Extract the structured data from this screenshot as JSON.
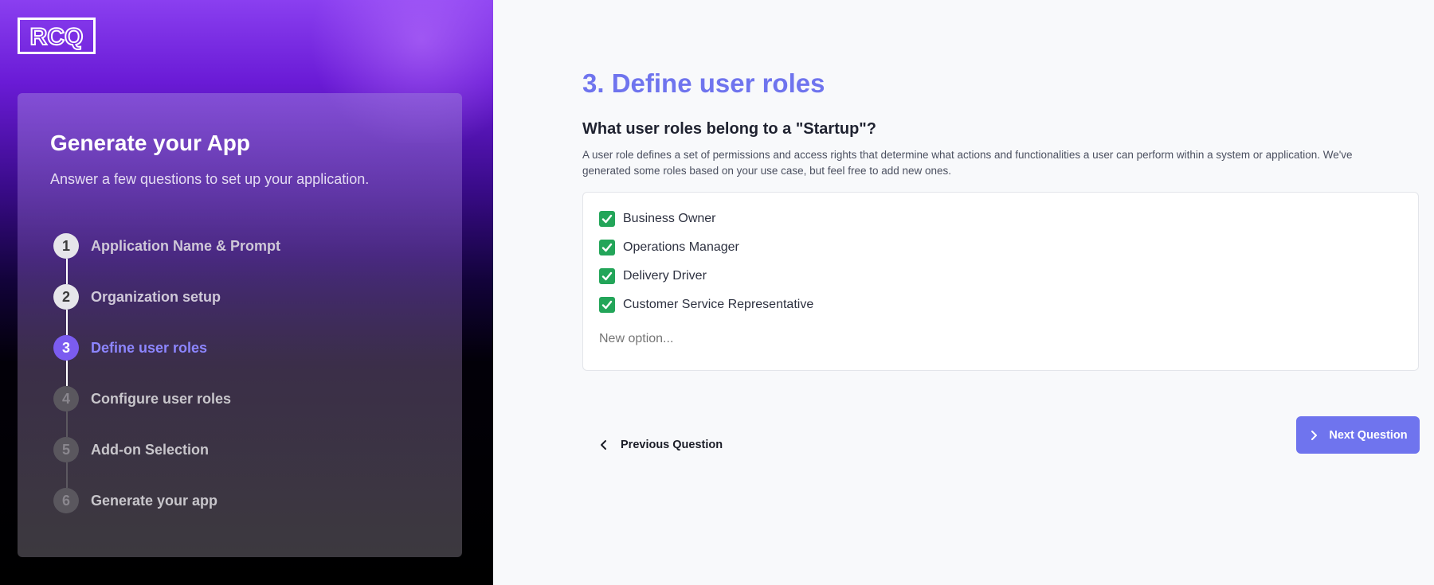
{
  "brand": {
    "logo_text": "RCQ"
  },
  "sidebar": {
    "title": "Generate your App",
    "subtitle": "Answer a few questions to set up your application.",
    "steps": [
      {
        "number": "1",
        "label": "Application Name & Prompt",
        "state": "done"
      },
      {
        "number": "2",
        "label": "Organization setup",
        "state": "done"
      },
      {
        "number": "3",
        "label": "Define user roles",
        "state": "active"
      },
      {
        "number": "4",
        "label": "Configure user roles",
        "state": "pending"
      },
      {
        "number": "5",
        "label": "Add-on Selection",
        "state": "pending"
      },
      {
        "number": "6",
        "label": "Generate your app",
        "state": "pending"
      }
    ]
  },
  "main": {
    "title": "3. Define user roles",
    "question": "What user roles belong to a \"Startup\"?",
    "description": "A user role defines a set of permissions and access rights that determine what actions and functionalities a user can perform within a system or application. We've generated some roles based on your use case, but feel free to add new ones.",
    "options": [
      {
        "label": "Business Owner",
        "checked": true
      },
      {
        "label": "Operations Manager",
        "checked": true
      },
      {
        "label": "Delivery Driver",
        "checked": true
      },
      {
        "label": "Customer Service Representative",
        "checked": true
      }
    ],
    "new_option_placeholder": "New option..."
  },
  "navigation": {
    "previous_label": "Previous Question",
    "next_label": "Next Question"
  },
  "colors": {
    "accent": "#6f74ee",
    "active_step": "#7b5cf0",
    "checkbox": "#23a559"
  },
  "icons": {
    "previous": "chevron-left-icon",
    "next": "chevron-right-icon",
    "checkbox": "check-icon"
  }
}
